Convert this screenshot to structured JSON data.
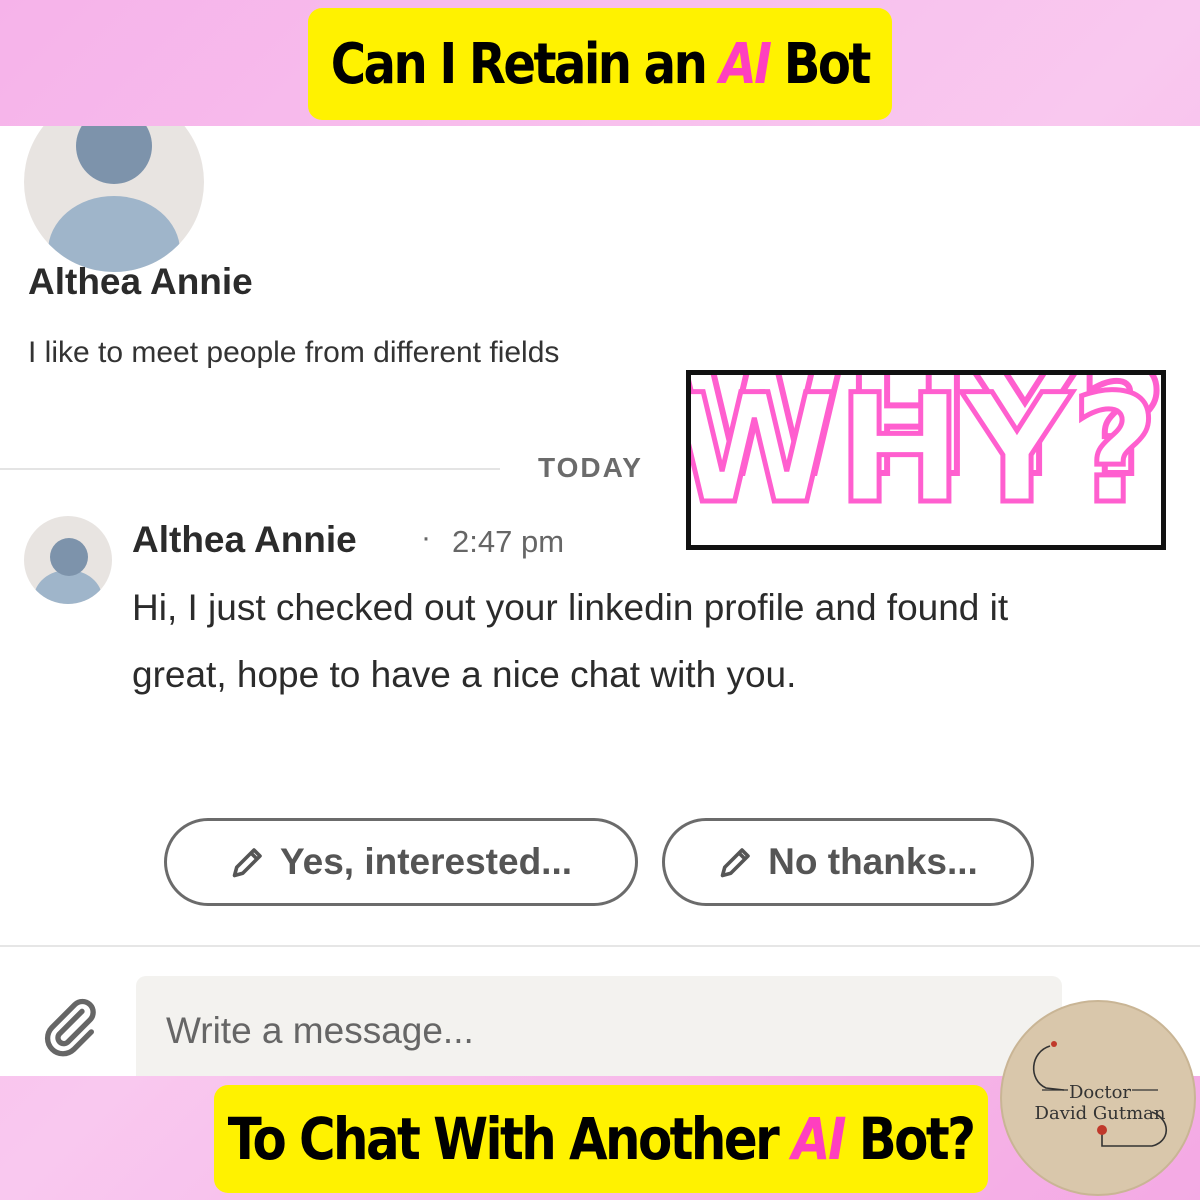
{
  "top_banner": {
    "before": "Can I Retain an ",
    "ai": "AI",
    "after": " Bot"
  },
  "bottom_banner": {
    "before": "To Chat With Another ",
    "ai": "AI",
    "after": " Bot?"
  },
  "profile": {
    "name": "Althea Annie",
    "headline": "I like to meet people from different fields",
    "avatar_icon": "default-avatar-icon"
  },
  "divider": {
    "label": "TODAY"
  },
  "overlay": {
    "text": "WHY?",
    "color": "#ff5fcf"
  },
  "message": {
    "sender": "Althea Annie",
    "separator": "·",
    "time": "2:47 pm",
    "body": "Hi, I just checked out your linkedin profile and found it great, hope to have a nice chat with you."
  },
  "quick_replies": [
    {
      "label": "Yes, interested...",
      "icon": "pencil-icon"
    },
    {
      "label": "No thanks...",
      "icon": "pencil-icon"
    }
  ],
  "composer": {
    "placeholder": "Write a message...",
    "attach_icon": "paperclip-icon"
  },
  "logo": {
    "line1": "Doctor",
    "line2": "David Gutman"
  },
  "colors": {
    "banner_bg": "#fff200",
    "accent_pink": "#ff3fbf",
    "page_bg": "#f6b3ea"
  }
}
